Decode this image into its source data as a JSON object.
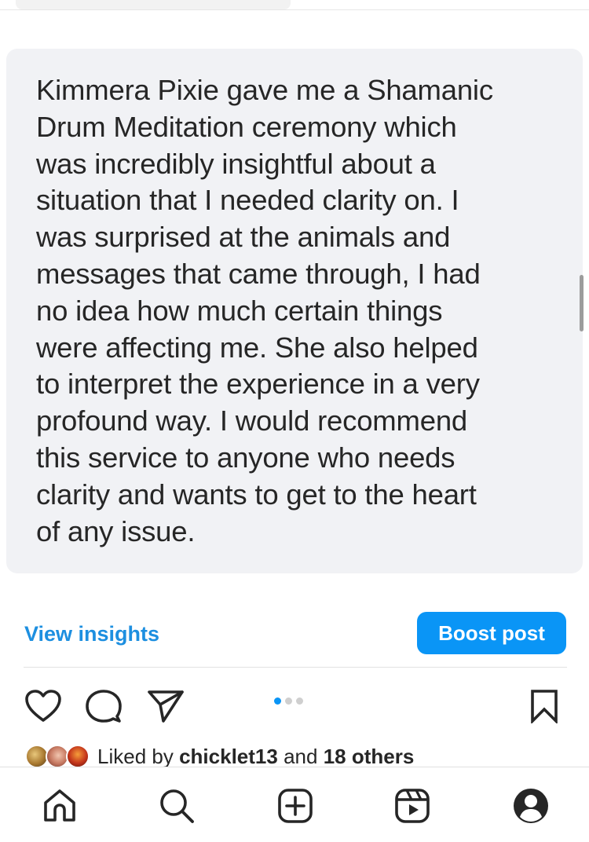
{
  "post": {
    "body_text": "Kimmera Pixie gave me a Shamanic\nDrum Meditation ceremony which\nwas incredibly insightful about a\nsituation that I needed clarity on. I\nwas surprised at the animals and\nmessages that came through, I had\nno idea how much certain things\nwere affecting me. She also helped\nto interpret the experience in a very\nprofound way. I would recommend\nthis service to anyone who needs\nclarity and wants to get to the heart\nof any issue."
  },
  "actions": {
    "view_insights_label": "View insights",
    "boost_post_label": "Boost post"
  },
  "carousel": {
    "total_slides": 3,
    "active_slide": 1
  },
  "likes": {
    "prefix": "Liked by",
    "user": "chicklet13",
    "conjunction": "and",
    "others": "18 others"
  },
  "icons": {
    "like": "heart-icon",
    "comment": "comment-icon",
    "share": "send-icon",
    "save": "bookmark-icon",
    "nav": [
      "home-icon",
      "search-icon",
      "create-post-icon",
      "reels-icon",
      "profile-icon"
    ]
  },
  "colors": {
    "accent": "#0a95f6",
    "link": "#1d8fe0",
    "card_background": "#f1f2f5",
    "text": "#262626"
  }
}
